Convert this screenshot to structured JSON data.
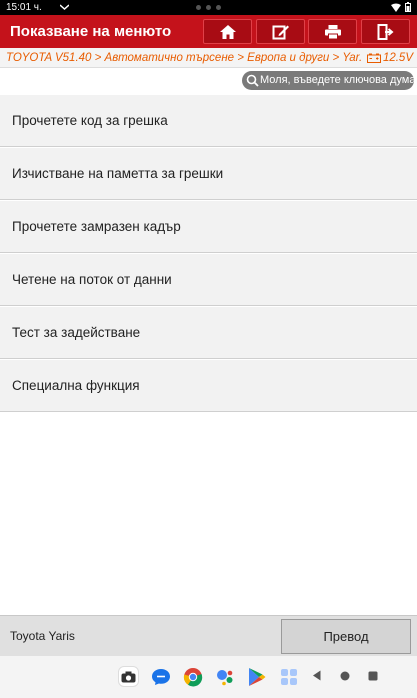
{
  "status_bar": {
    "time": "15:01 ч."
  },
  "app_bar": {
    "title": "Показване на менюто",
    "buttons": [
      "home-icon",
      "edit-icon",
      "print-icon",
      "exit-icon"
    ]
  },
  "breadcrumb": {
    "path": "TOYOTA V51.40 > Автоматично търсене > Европа и други > Yar...",
    "voltage": "12.5V"
  },
  "search": {
    "placeholder": "Моля, въведете ключова дума"
  },
  "menu": {
    "items": [
      "Прочетете код за грешка",
      "Изчистване на паметта за грешки",
      "Прочетете замразен кадър",
      "Четене на поток от данни",
      "Тест за задействане",
      "Специална функция"
    ]
  },
  "footer": {
    "vehicle": "Toyota Yaris",
    "translate_label": "Превод"
  },
  "colors": {
    "accent": "#c4121b",
    "breadcrumb_text": "#e85c00"
  }
}
